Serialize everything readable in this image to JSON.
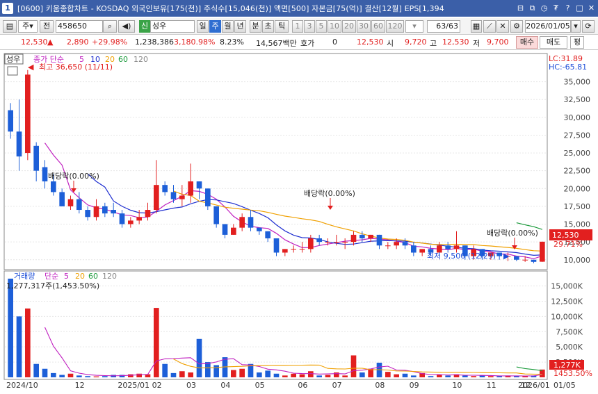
{
  "window": {
    "badge": "1",
    "title": "[0600] 키움종합차트 - KOSDAQ 외국인보유[175(천)] 주식수[15,046(천)] 액면[500] 자본금[75(억)] 결산[12월] EPS[1,394",
    "buttons": [
      "⊟",
      "⧉",
      "◷",
      "₮",
      "?",
      "□",
      "✕"
    ]
  },
  "toolbar": {
    "period_select": "주",
    "prev_label": "전",
    "stock_code": "458650",
    "new_badge": "신",
    "stock_name": "성우",
    "periods": [
      "일",
      "주",
      "월",
      "년",
      "분",
      "초",
      "틱"
    ],
    "active_period": "주",
    "intervals": [
      "1",
      "3",
      "5",
      "10",
      "20",
      "30",
      "60",
      "120"
    ],
    "count": "63/63",
    "date": "2026/01/05"
  },
  "quote": {
    "price": "12,530",
    "change": "2,890",
    "change_pct": "+29.98%",
    "volume": "1,238,386",
    "vol_ratio": "3,180.98%",
    "turnover": "8.23%",
    "amount": "14,567백만",
    "bid_label": "호가",
    "bid_value": "0",
    "bid_price": "12,530",
    "open_label": "시",
    "open": "9,720",
    "high_label": "고",
    "high": "12,530",
    "low_label": "저",
    "low": "9,700",
    "buy_label": "매수",
    "sell_label": "매도",
    "avg_label": "평"
  },
  "price_panel": {
    "stock_tag": "성우",
    "ma_title": "종가 단순",
    "ma_periods": [
      "5",
      "10",
      "20",
      "60",
      "120"
    ],
    "ma_colors": [
      "#c020c0",
      "#1f2fd0",
      "#f0a000",
      "#1a9a3a",
      "#888888"
    ],
    "lc": "LC:31.89",
    "hc": "HC:-65.81",
    "high_note": "최고 36,650 (11/11)",
    "low_note": "최저 9,500 (12/29)",
    "div_labels": [
      "배당락(0.00%)",
      "배당락(0.00%)",
      "배당락(0.00%)"
    ],
    "current_price": "12,530",
    "current_pct": "29.71%",
    "y_ticks": [
      "35,000",
      "32,500",
      "30,000",
      "27,500",
      "25,000",
      "22,500",
      "20,000",
      "17,500",
      "15,000",
      "12,500",
      "10,000"
    ]
  },
  "volume_panel": {
    "title": "거래량",
    "ma_title": "단순",
    "ma_periods": [
      "5",
      "20",
      "60",
      "120"
    ],
    "max_note": "1,277,317주(1,453.50%)",
    "y_ticks": [
      "15,000K",
      "12,500K",
      "10,000K",
      "7,500K",
      "5,000K",
      "2,500K"
    ],
    "current_vol": "1,277K",
    "current_pct": "1453.50%"
  },
  "x_axis": [
    "2024/10",
    "12",
    "2025/01",
    "02",
    "03",
    "04",
    "05",
    "06",
    "07",
    "08",
    "09",
    "10",
    "11",
    "12",
    "2026/01",
    "01/05"
  ],
  "chart_data": {
    "type": "candlestick",
    "x_ticks": [
      "2024/10",
      "12",
      "2025/01",
      "02",
      "03",
      "04",
      "05",
      "06",
      "07",
      "08",
      "09",
      "10",
      "11",
      "12",
      "2026/01"
    ],
    "candles": [
      [
        31000,
        28000,
        32000,
        27000
      ],
      [
        28000,
        24500,
        32500,
        22500
      ],
      [
        25000,
        36000,
        36650,
        24000
      ],
      [
        26000,
        22500,
        26500,
        21000
      ],
      [
        23000,
        21000,
        24000,
        20000
      ],
      [
        21000,
        19500,
        22000,
        19000
      ],
      [
        19500,
        17500,
        20000,
        17500
      ],
      [
        17500,
        18500,
        19000,
        17000
      ],
      [
        18500,
        17000,
        19500,
        16500
      ],
      [
        17000,
        16000,
        17500,
        15500
      ],
      [
        16000,
        17500,
        18500,
        15500
      ],
      [
        17500,
        16500,
        18000,
        16000
      ],
      [
        17000,
        16500,
        18000,
        16000
      ],
      [
        16500,
        15000,
        17000,
        14500
      ],
      [
        15000,
        15500,
        16000,
        14500
      ],
      [
        15500,
        16000,
        17000,
        15000
      ],
      [
        16000,
        17000,
        18000,
        15500
      ],
      [
        17000,
        20500,
        24000,
        16500
      ],
      [
        20500,
        19500,
        21000,
        19000
      ],
      [
        19500,
        18500,
        20500,
        18000
      ],
      [
        18500,
        19000,
        20500,
        17500
      ],
      [
        19000,
        21000,
        23500,
        18000
      ],
      [
        21000,
        20000,
        21000,
        18500
      ],
      [
        20000,
        17500,
        20000,
        17000
      ],
      [
        17500,
        15000,
        17500,
        14500
      ],
      [
        15000,
        13500,
        15000,
        13000
      ],
      [
        13500,
        14500,
        15000,
        13500
      ],
      [
        14500,
        16000,
        16500,
        14000
      ],
      [
        16000,
        14500,
        17000,
        14000
      ],
      [
        14500,
        14000,
        14500,
        13500
      ],
      [
        14000,
        13000,
        14000,
        12500
      ],
      [
        13000,
        11000,
        13000,
        10500
      ],
      [
        11000,
        11500,
        11500,
        10500
      ],
      [
        11500,
        11500,
        12000,
        11000
      ],
      [
        11500,
        11500,
        12500,
        11000
      ],
      [
        11500,
        13000,
        13500,
        11000
      ],
      [
        13000,
        12500,
        13500,
        12000
      ],
      [
        12500,
        12500,
        13000,
        12000
      ],
      [
        12500,
        12500,
        13500,
        12000
      ],
      [
        12500,
        12500,
        13000,
        11500
      ],
      [
        12500,
        13500,
        14000,
        12000
      ],
      [
        13500,
        13000,
        14000,
        12500
      ],
      [
        13000,
        13500,
        13500,
        12500
      ],
      [
        13500,
        12000,
        13500,
        11500
      ],
      [
        12000,
        12000,
        12500,
        11500
      ],
      [
        12000,
        12500,
        13000,
        11500
      ],
      [
        12500,
        12000,
        13000,
        11500
      ],
      [
        12000,
        11000,
        12500,
        10500
      ],
      [
        11000,
        11500,
        11500,
        10500
      ],
      [
        11500,
        11000,
        12000,
        10500
      ],
      [
        11000,
        12000,
        12500,
        11000
      ],
      [
        12000,
        11500,
        12500,
        11000
      ],
      [
        11500,
        12000,
        14000,
        11000
      ],
      [
        12000,
        10500,
        12000,
        10000
      ],
      [
        10500,
        11500,
        12000,
        10000
      ],
      [
        11500,
        10500,
        11500,
        10000
      ],
      [
        10500,
        11000,
        11000,
        10000
      ],
      [
        11000,
        10500,
        11000,
        10000
      ],
      [
        10500,
        10500,
        11000,
        9800
      ],
      [
        10500,
        10000,
        10500,
        9800
      ],
      [
        10000,
        10000,
        10500,
        9700
      ],
      [
        10000,
        9700,
        10000,
        9500
      ],
      [
        9720,
        12530,
        12530,
        9700
      ]
    ],
    "volume_k": [
      16200,
      10000,
      11300,
      2200,
      1400,
      700,
      400,
      600,
      300,
      200,
      150,
      200,
      400,
      400,
      500,
      600,
      500,
      11400,
      2200,
      700,
      1000,
      800,
      6300,
      2500,
      2000,
      3300,
      1200,
      1400,
      2200,
      800,
      1100,
      600,
      300,
      600,
      500,
      1000,
      300,
      400,
      800,
      300,
      3600,
      800,
      1400,
      2400,
      900,
      500,
      600,
      300,
      700,
      200,
      400,
      300,
      500,
      300,
      200,
      300,
      200,
      200,
      300,
      200,
      200,
      300,
      1277
    ],
    "price_range": [
      9000,
      37500
    ],
    "volume_range": [
      0,
      17000
    ]
  }
}
